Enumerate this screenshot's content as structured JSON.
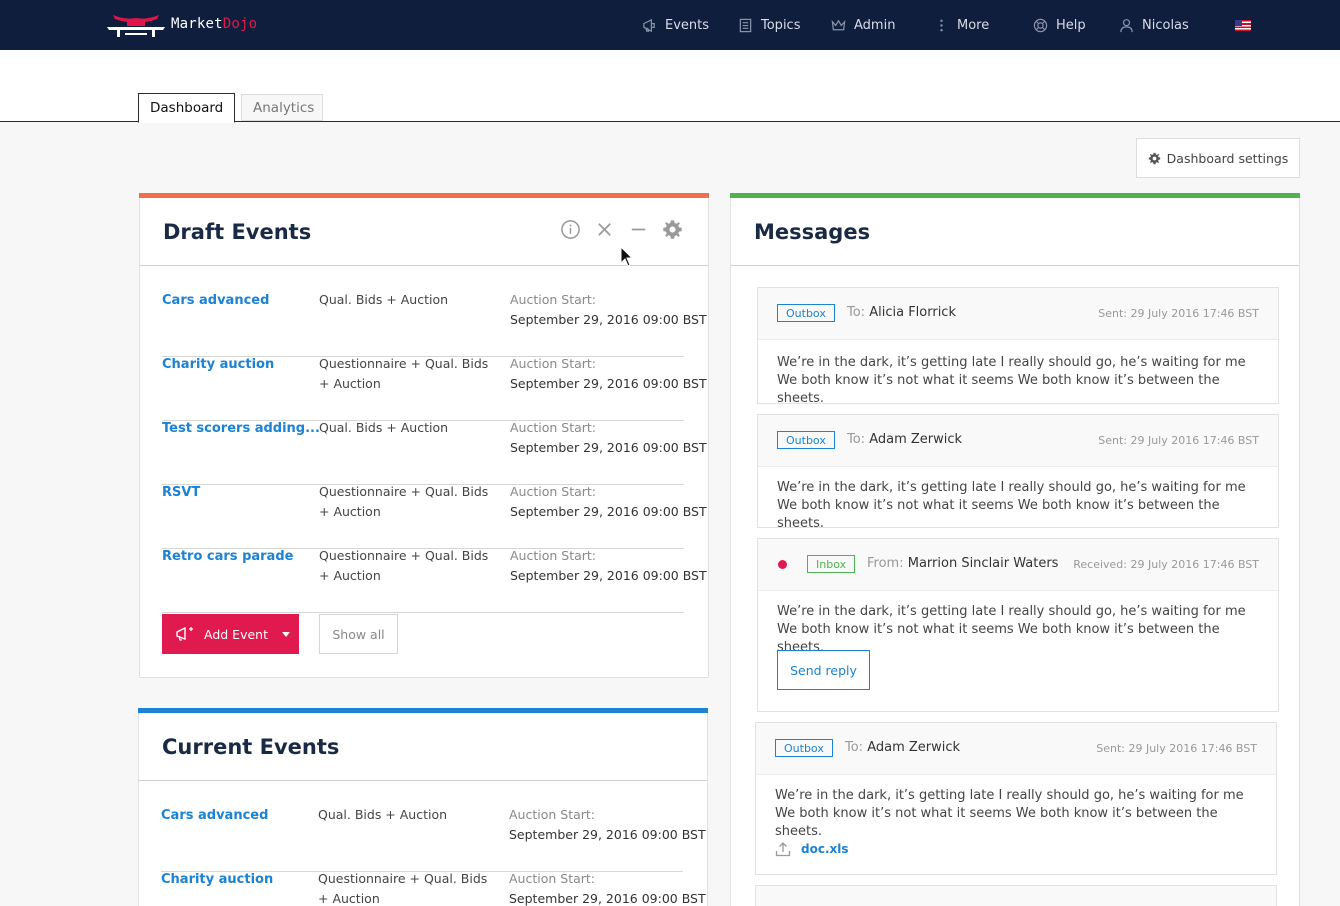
{
  "brand": {
    "name_part1": "Market",
    "name_part2": "Dojo"
  },
  "nav": {
    "events": "Events",
    "topics": "Topics",
    "admin": "Admin",
    "more": "More",
    "help": "Help",
    "user": "Nicolas"
  },
  "tabs": {
    "dashboard": "Dashboard",
    "analytics": "Analytics"
  },
  "dashboard_settings": "Dashboard settings",
  "draft_events": {
    "title": "Draft Events",
    "rows": [
      {
        "name": "Cars advanced",
        "type": "Qual. Bids + Auction",
        "label": "Auction Start:",
        "date": "September 29, 2016 09:00 BST"
      },
      {
        "name": "Charity auction",
        "type": "Questionnaire + Qual. Bids + Auction",
        "label": "Auction Start:",
        "date": "September 29, 2016 09:00 BST"
      },
      {
        "name": "Test scorers adding...",
        "type": "Qual. Bids + Auction",
        "label": "Auction Start:",
        "date": "September 29, 2016 09:00 BST"
      },
      {
        "name": "RSVT",
        "type": "Questionnaire + Qual. Bids + Auction",
        "label": "Auction Start:",
        "date": "September 29, 2016 09:00 BST"
      },
      {
        "name": "Retro cars parade",
        "type": "Questionnaire + Qual. Bids + Auction",
        "label": "Auction Start:",
        "date": "September 29, 2016 09:00 BST"
      }
    ],
    "add_event": "Add Event",
    "show_all": "Show all"
  },
  "current_events": {
    "title": "Current Events",
    "rows": [
      {
        "name": "Cars advanced",
        "type": "Qual. Bids + Auction",
        "label": "Auction Start:",
        "date": "September 29, 2016 09:00 BST"
      },
      {
        "name": "Charity auction",
        "type": "Questionnaire + Qual. Bids + Auction",
        "label": "Auction Start:",
        "date": "September 29, 2016 09:00 BST"
      }
    ]
  },
  "messages": {
    "title": "Messages",
    "items": [
      {
        "badge": "Outbox",
        "prefix": "To:",
        "person": "Alicia Florrick",
        "time": "Sent: 29 July 2016 17:46 BST",
        "body": "We’re in the dark, it’s getting late I really should go, he’s waiting for me We both know it’s not what it seems We both know it’s between the sheets."
      },
      {
        "badge": "Outbox",
        "prefix": "To:",
        "person": "Adam Zerwick",
        "time": "Sent: 29 July 2016 17:46 BST",
        "body": "We’re in the dark, it’s getting late I really should go, he’s waiting for me We both know it’s not what it seems We both know it’s between the sheets."
      },
      {
        "badge": "Inbox",
        "prefix": "From:",
        "person": "Marrion Sinclair Waters",
        "time": "Received: 29 July 2016 17:46 BST",
        "body": "We’re in the dark, it’s getting late I really should go, he’s waiting for me We both know it’s not what it seems We both know it’s between the sheets.",
        "reply": "Send reply"
      },
      {
        "badge": "Outbox",
        "prefix": "To:",
        "person": "Adam Zerwick",
        "time": "Sent: 29 July 2016 17:46 BST",
        "body": "We’re in the dark, it’s getting late I really should go, he’s waiting for me We both know it’s not what it seems We both know it’s between the sheets.",
        "attachment": "doc.xls"
      }
    ]
  },
  "colors": {
    "nav_bg": "#0f1e3d",
    "accent_red": "#e0194f",
    "link_blue": "#1b82d4",
    "draft_bar": "#f26c4f",
    "messages_bar": "#4fb34f",
    "current_bar": "#1b82d4"
  }
}
